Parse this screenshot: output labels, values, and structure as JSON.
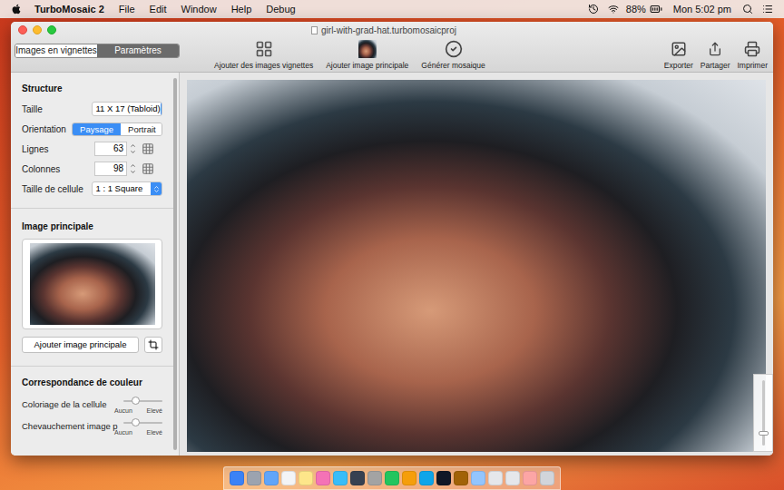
{
  "menubar": {
    "app": "TurboMosaic 2",
    "items": [
      "File",
      "Edit",
      "Window",
      "Help",
      "Debug"
    ],
    "battery": "88%",
    "clock": "Mon 5:02 pm"
  },
  "window": {
    "title": "girl-with-grad-hat.turbomosaicproj"
  },
  "tabs": [
    {
      "label": "Images en vignettes",
      "selected": false
    },
    {
      "label": "Paramètres",
      "selected": true
    }
  ],
  "toolbar": [
    {
      "label": "Ajouter des images vignettes"
    },
    {
      "label": "Ajouter image principale"
    },
    {
      "label": "Générer mosaique"
    }
  ],
  "toolbar_right": [
    {
      "label": "Exporter"
    },
    {
      "label": "Partager"
    },
    {
      "label": "Imprimer"
    }
  ],
  "structure": {
    "title": "Structure",
    "size": {
      "label": "Taille",
      "value": "11 X 17 (Tabloid)"
    },
    "orientation": {
      "label": "Orientation",
      "options": [
        {
          "label": "Paysage",
          "selected": true
        },
        {
          "label": "Portrait",
          "selected": false
        }
      ]
    },
    "rows": {
      "label": "Lignes",
      "value": "63"
    },
    "columns": {
      "label": "Colonnes",
      "value": "98"
    },
    "cell": {
      "label": "Taille de cellule",
      "value": "1 : 1 Square"
    }
  },
  "main_image": {
    "title": "Image principale",
    "button": "Ajouter image principale"
  },
  "color_matching": {
    "title": "Correspondance de couleur",
    "sliders": [
      {
        "label": "Coloriage de la cellule",
        "level": 0.3,
        "min": "Aucun",
        "max": "Elevé"
      },
      {
        "label": "Chevauchement image p",
        "level": 0.3,
        "min": "Aucun",
        "max": "Elevé"
      }
    ]
  },
  "zoom": {
    "level": 0.15
  }
}
